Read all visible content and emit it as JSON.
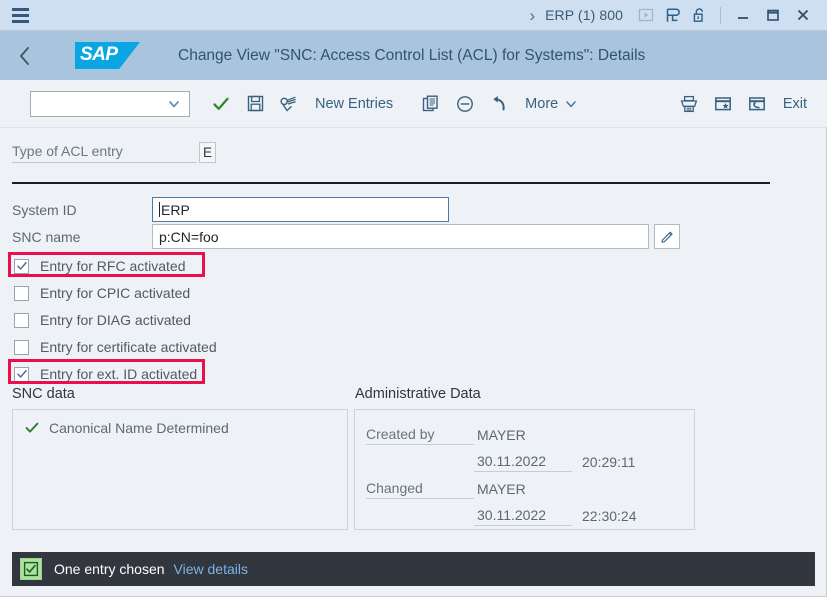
{
  "shellbar": {
    "menu_icon": "hamburger-menu-icon",
    "chevron": "›",
    "system_id": "ERP (1) 800",
    "icons": [
      {
        "name": "command-field-icon",
        "glyph": "▶"
      },
      {
        "name": "new-session-icon",
        "glyph": "P"
      },
      {
        "name": "lock-open-icon",
        "glyph": "lock"
      }
    ],
    "window_buttons": [
      {
        "name": "minimize-button",
        "glyph": "_"
      },
      {
        "name": "maximize-button",
        "glyph": "▢"
      },
      {
        "name": "close-button",
        "glyph": "✕"
      }
    ]
  },
  "header": {
    "back_label": "‹",
    "logo_text": "SAP",
    "title": "Change View \"SNC: Access Control List (ACL) for Systems\": Details"
  },
  "toolbar": {
    "variant_select_value": "",
    "variant_select_placeholder": "",
    "check_label": "check-icon",
    "save_label": "save-icon",
    "display_change_label": "display-change-icon",
    "new_entries_label": "New Entries",
    "copy_label": "copy-as-icon",
    "delete_label": "delete-icon",
    "undo_label": "undo-icon",
    "more_label": "More",
    "print_label": "print-icon",
    "create_shortcut_label": "create-shortcut-icon",
    "generate_label": "generate-icon",
    "exit_label": "Exit"
  },
  "form": {
    "acl_type_label": "Type of ACL entry",
    "acl_type_value": "E",
    "system_id_label": "System ID",
    "system_id_value": "ERP",
    "snc_name_label": "SNC name",
    "snc_name_value": "p:CN=foo",
    "edit_button_label": "pencil-icon",
    "checkboxes": [
      {
        "label": "Entry for RFC activated",
        "checked": true,
        "highlighted": true
      },
      {
        "label": "Entry for CPIC activated",
        "checked": false,
        "highlighted": false
      },
      {
        "label": "Entry for DIAG activated",
        "checked": false,
        "highlighted": false
      },
      {
        "label": "Entry for certificate activated",
        "checked": false,
        "highlighted": false
      },
      {
        "label": "Entry for ext. ID activated",
        "checked": true,
        "highlighted": true
      }
    ]
  },
  "snc_data": {
    "title": "SNC data",
    "item_label": "Canonical Name Determined",
    "item_icon": "green-check-icon"
  },
  "admin_data": {
    "title": "Administrative Data",
    "created_by_label": "Created by",
    "created_by_value": "MAYER",
    "created_date": "30.11.2022",
    "created_time": "20:29:11",
    "changed_label": "Changed",
    "changed_by_value": "MAYER",
    "changed_date": "30.11.2022",
    "changed_time": "22:30:24"
  },
  "statusbar": {
    "icon": "checked-box-icon",
    "message": "One entry chosen",
    "link_label": "View details"
  },
  "colors": {
    "shell_bg": "#cddff0",
    "header_bg": "#a9c5de",
    "body_bg": "#eef2f6",
    "sap_blue": "#0aa6e4",
    "highlight_red": "#eb0f4b",
    "status_bg": "#32363f",
    "status_link": "#7cb3e8",
    "green_check": "#2b7d2b"
  }
}
